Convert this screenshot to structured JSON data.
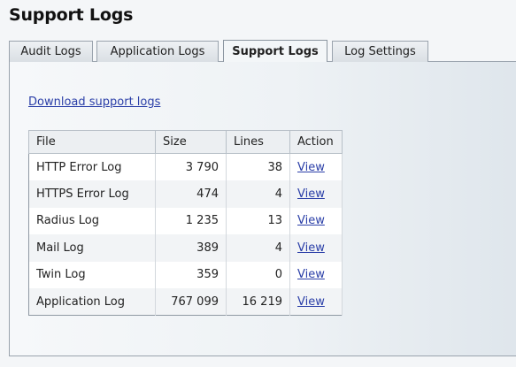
{
  "page_title": "Support Logs",
  "tabs": [
    {
      "label": "Audit Logs"
    },
    {
      "label": "Application Logs"
    },
    {
      "label": "Support Logs"
    },
    {
      "label": "Log Settings"
    }
  ],
  "download_link": "Download support logs",
  "table": {
    "headers": {
      "file": "File",
      "size": "Size",
      "lines": "Lines",
      "action": "Action"
    },
    "rows": [
      {
        "file": "HTTP Error Log",
        "size": "3 790",
        "lines": "38",
        "action": "View"
      },
      {
        "file": "HTTPS Error Log",
        "size": "474",
        "lines": "4",
        "action": "View"
      },
      {
        "file": "Radius Log",
        "size": "1 235",
        "lines": "13",
        "action": "View"
      },
      {
        "file": "Mail Log",
        "size": "389",
        "lines": "4",
        "action": "View"
      },
      {
        "file": "Twin Log",
        "size": "359",
        "lines": "0",
        "action": "View"
      },
      {
        "file": "Application Log",
        "size": "767 099",
        "lines": "16 219",
        "action": "View"
      }
    ]
  },
  "colors": {
    "link": "#2b3fa8",
    "border": "#9aa3ad"
  }
}
